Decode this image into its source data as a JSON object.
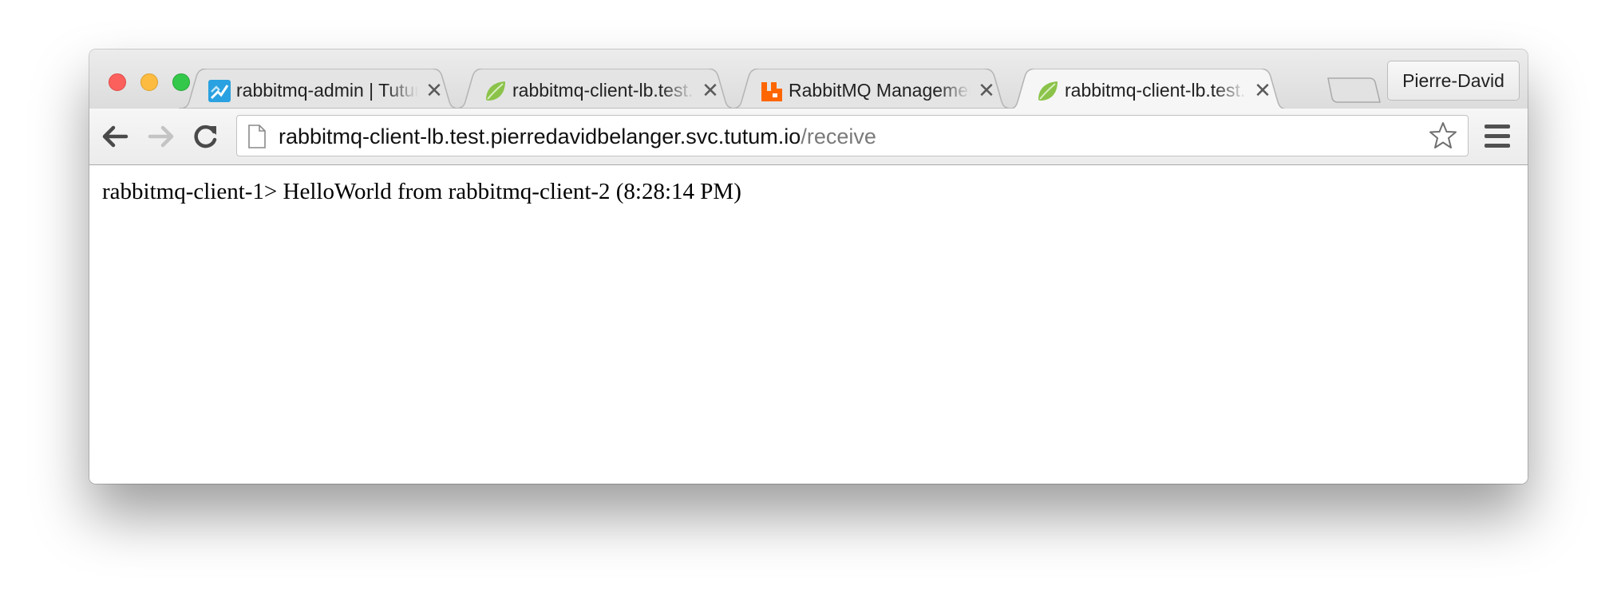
{
  "browser": {
    "tabs": [
      {
        "title": "rabbitmq-admin | Tutum",
        "icon": "tutum-icon",
        "active": false
      },
      {
        "title": "rabbitmq-client-lb.test.pierredavidbelanger.svc.tutum.io/receive",
        "icon": "spring-leaf-icon",
        "active": false
      },
      {
        "title": "RabbitMQ Management",
        "icon": "rabbitmq-icon",
        "active": false
      },
      {
        "title": "rabbitmq-client-lb.test.pierredavidbelanger.svc.tutum.io/receive",
        "icon": "spring-leaf-icon",
        "active": true
      }
    ],
    "tab_close_glyph": "✕",
    "profile_name": "Pierre-David",
    "omnibox": {
      "host": "rabbitmq-client-lb.test.pierredavidbelanger.svc.tutum.io",
      "path": "/receive"
    }
  },
  "page": {
    "message": "rabbitmq-client-1> HelloWorld from rabbitmq-client-2 (8:28:14 PM)"
  },
  "colors": {
    "close": "#fc605c",
    "minimize": "#fdbc40",
    "maximize": "#34c84a",
    "tutum_blue": "#2aa1e0",
    "spring_green": "#8bc34a",
    "rabbitmq_orange": "#ff6600"
  }
}
